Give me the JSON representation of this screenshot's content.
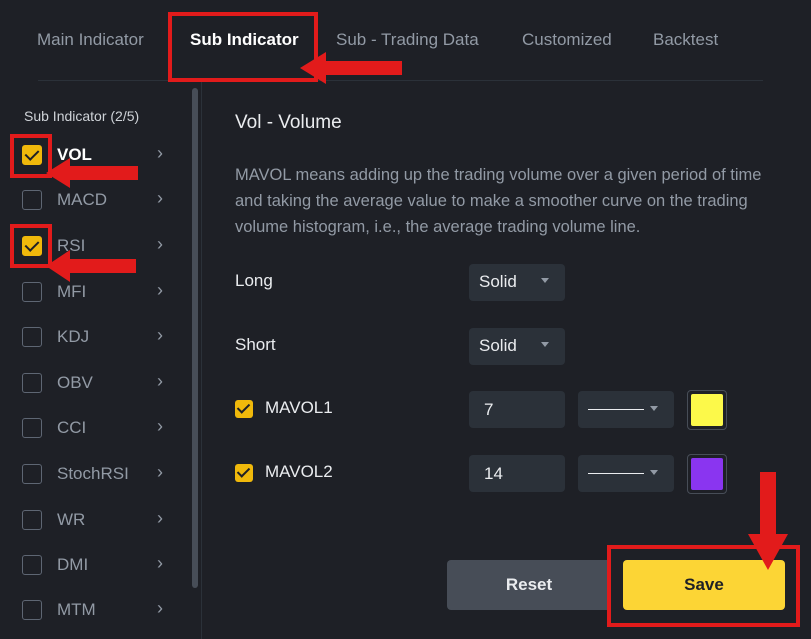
{
  "tabs": [
    {
      "label": "Main Indicator"
    },
    {
      "label": "Sub Indicator",
      "active": true
    },
    {
      "label": "Sub - Trading Data"
    },
    {
      "label": "Customized"
    },
    {
      "label": "Backtest"
    }
  ],
  "sidebar": {
    "title": "Sub Indicator (2/5)",
    "items": [
      {
        "label": "VOL",
        "checked": true
      },
      {
        "label": "MACD",
        "checked": false
      },
      {
        "label": "RSI",
        "checked": true
      },
      {
        "label": "MFI",
        "checked": false
      },
      {
        "label": "KDJ",
        "checked": false
      },
      {
        "label": "OBV",
        "checked": false
      },
      {
        "label": "CCI",
        "checked": false
      },
      {
        "label": "StochRSI",
        "checked": false
      },
      {
        "label": "WR",
        "checked": false
      },
      {
        "label": "DMI",
        "checked": false
      },
      {
        "label": "MTM",
        "checked": false
      }
    ]
  },
  "main": {
    "title": "Vol - Volume",
    "description": "MAVOL means adding up the trading volume over a given period of time and taking the average value to make a smoother curve on the trading volume histogram, i.e., the average trading volume line.",
    "long": {
      "label": "Long",
      "value": "Solid"
    },
    "short": {
      "label": "Short",
      "value": "Solid"
    },
    "mavol1": {
      "label": "MAVOL1",
      "checked": true,
      "value": "7",
      "color": "#fcf94a"
    },
    "mavol2": {
      "label": "MAVOL2",
      "checked": true,
      "value": "14",
      "color": "#8a35f0"
    },
    "reset_label": "Reset",
    "save_label": "Save"
  },
  "colors": {
    "background": "#1e2026",
    "accent": "#f0b90b",
    "save_button": "#fcd535",
    "annotation": "#e21b1b"
  }
}
